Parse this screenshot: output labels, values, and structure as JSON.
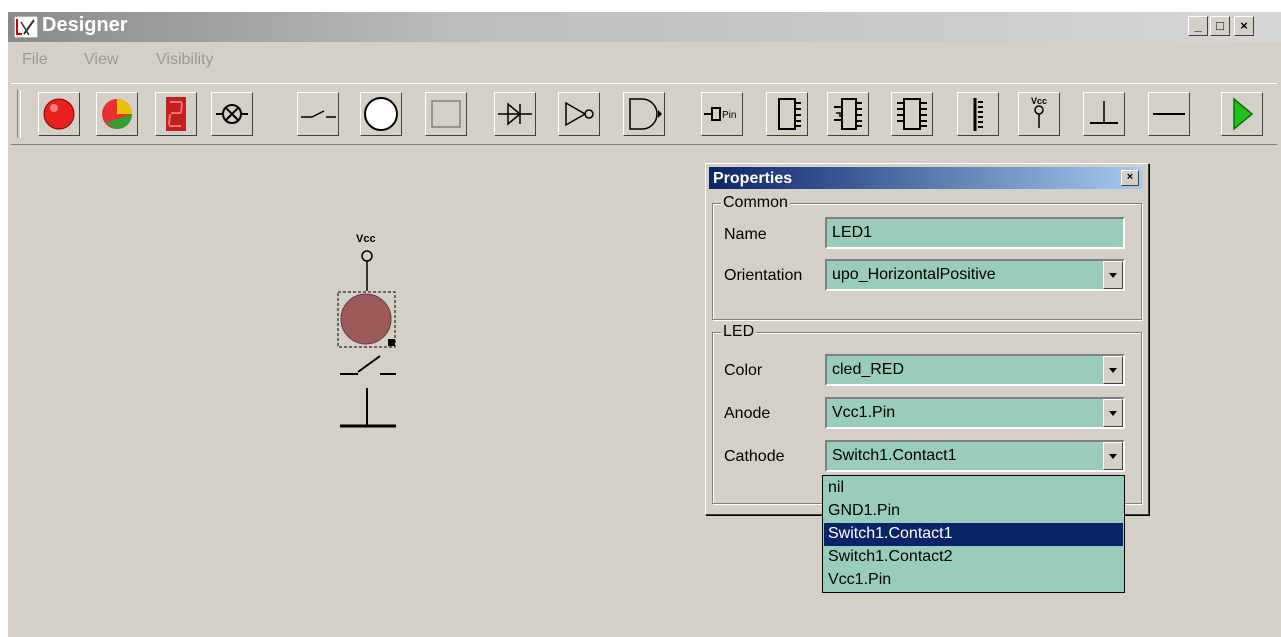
{
  "window": {
    "title": "Designer",
    "caption_buttons": [
      "minimize-icon",
      "maximize-icon",
      "close-icon"
    ]
  },
  "menu": [
    "File",
    "View",
    "Visibility"
  ],
  "toolbar": {
    "buttons": [
      "red-led-icon",
      "bicolor-led-icon",
      "seven-segment-icon",
      "lamp-icon",
      "switch-icon",
      "circle-icon",
      "rectangle-icon",
      "diode-icon",
      "inverter-icon",
      "and-gate-icon",
      "pin-icon",
      "chip-1-icon",
      "chip-2-icon",
      "chip-3-icon",
      "resistor-icon",
      "vcc-icon",
      "ground-icon",
      "wire-icon",
      "run-icon"
    ],
    "pin_label": "Pin",
    "vcc_label": "Vcc"
  },
  "canvas": {
    "vcc_label": "Vcc"
  },
  "properties": {
    "title": "Properties",
    "common": {
      "label": "Common",
      "name_label": "Name",
      "name_value": "LED1",
      "orientation_label": "Orientation",
      "orientation_value": "upo_HorizontalPositive"
    },
    "led": {
      "label": "LED",
      "color_label": "Color",
      "color_value": "cled_RED",
      "anode_label": "Anode",
      "anode_value": "Vcc1.Pin",
      "cathode_label": "Cathode",
      "cathode_value": "Switch1.Contact1"
    },
    "cathode_options": [
      "nil",
      "GND1.Pin",
      "Switch1.Contact1",
      "Switch1.Contact2",
      "Vcc1.Pin"
    ],
    "cathode_selected_index": 2
  },
  "colors": {
    "field_bg": "#99ccbb",
    "selection": "#0a246a",
    "window_bg": "#d4d0c8",
    "led_fill": "#9c5a5a"
  }
}
